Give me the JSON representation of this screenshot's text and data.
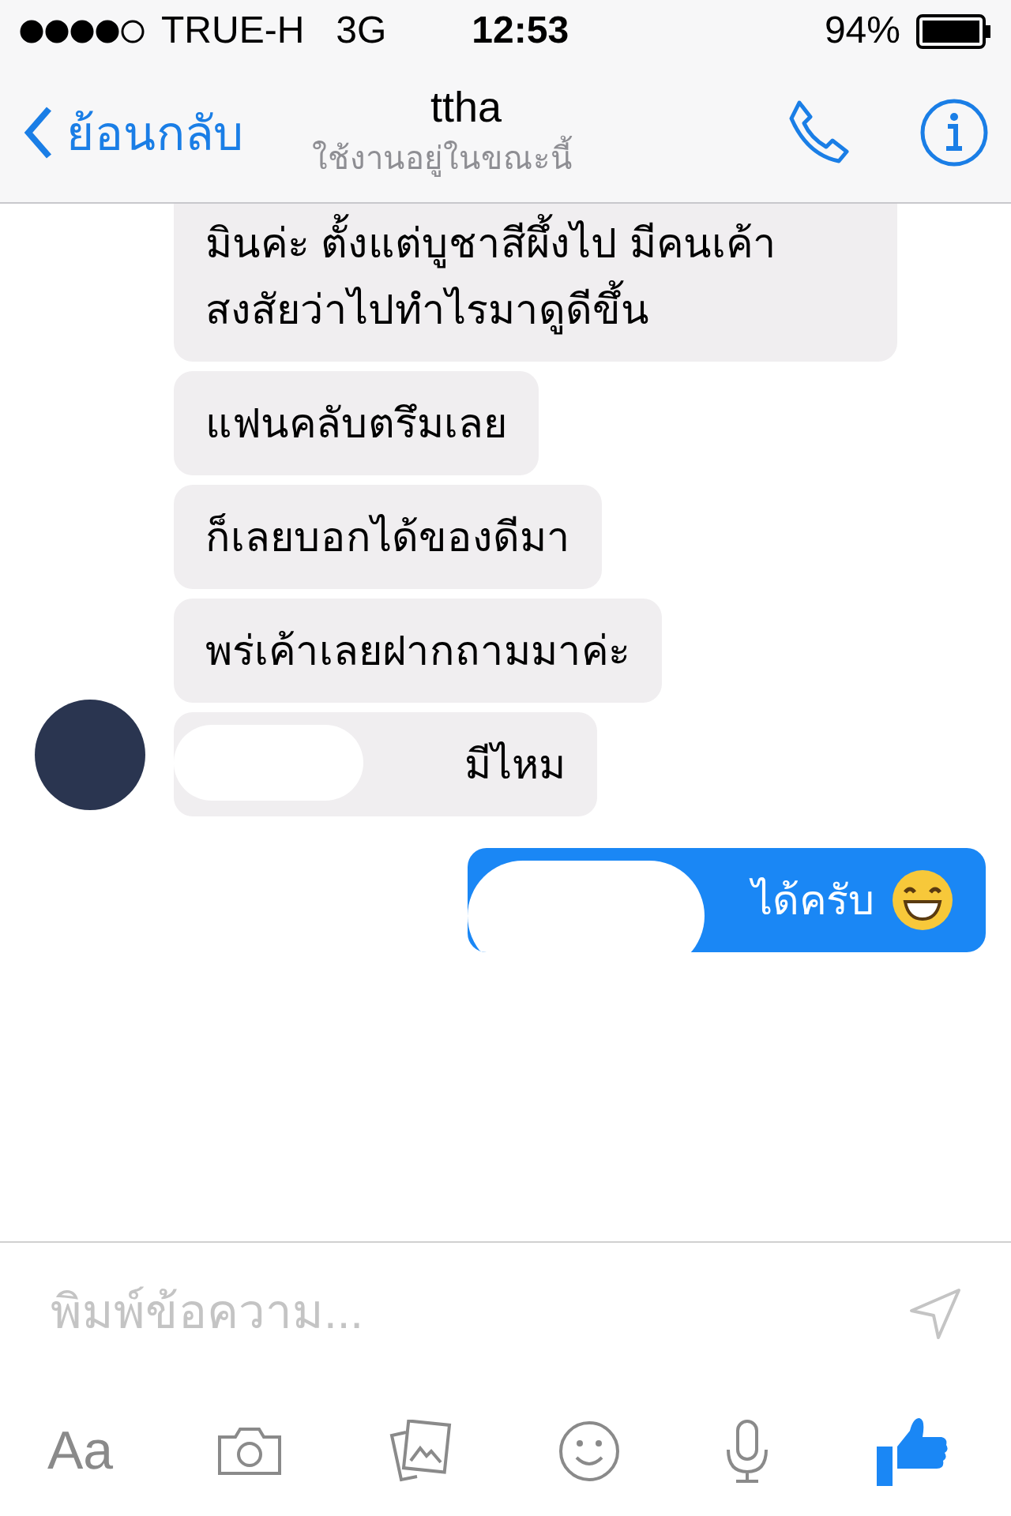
{
  "status_bar": {
    "carrier": "TRUE-H",
    "network": "3G",
    "time": "12:53",
    "battery": "94%"
  },
  "nav": {
    "back": "ย้อนกลับ",
    "title": "ttha",
    "subtitle": "ใช้งานอยู่ในขณะนี้"
  },
  "messages": [
    {
      "kind": "in",
      "text": "มินค่ะ ตั้งแต่บูชาสีผึ้งไป มีคนเค้าสงสัยว่าไปทำไรมาดูดีขึ้น",
      "redacted": false
    },
    {
      "kind": "in",
      "text": "แฟนคลับตรึมเลย",
      "redacted": false
    },
    {
      "kind": "in",
      "text": "ก็เลยบอกได้ของดีมา",
      "redacted": false
    },
    {
      "kind": "in",
      "text": "พร่เค้าเลยฝากถามมาค่ะ",
      "redacted": false
    },
    {
      "kind": "in",
      "text": "มีไหม",
      "redacted": true,
      "avatar": true
    },
    {
      "kind": "out",
      "text": "ได้ครับ",
      "redacted": true,
      "emoji": true
    }
  ],
  "composer": {
    "placeholder": "พิมพ์ข้อความ..."
  },
  "toolbar": {
    "text_button": "Aa"
  }
}
